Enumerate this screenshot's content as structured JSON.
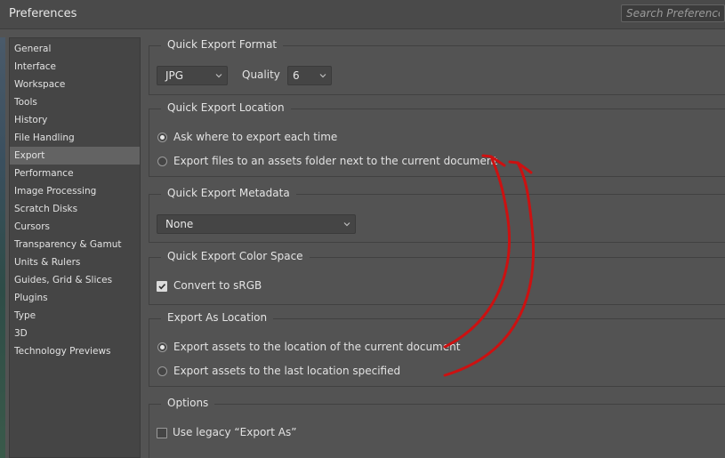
{
  "window": {
    "title": "Preferences",
    "search_placeholder": "Search Preferences"
  },
  "sidebar": {
    "items": [
      {
        "label": "General"
      },
      {
        "label": "Interface"
      },
      {
        "label": "Workspace"
      },
      {
        "label": "Tools"
      },
      {
        "label": "History"
      },
      {
        "label": "File Handling"
      },
      {
        "label": "Export",
        "active": true
      },
      {
        "label": "Performance"
      },
      {
        "label": "Image Processing"
      },
      {
        "label": "Scratch Disks"
      },
      {
        "label": "Cursors"
      },
      {
        "label": "Transparency & Gamut"
      },
      {
        "label": "Units & Rulers"
      },
      {
        "label": "Guides, Grid & Slices"
      },
      {
        "label": "Plugins"
      },
      {
        "label": "Type"
      },
      {
        "label": "3D"
      },
      {
        "label": "Technology Previews"
      }
    ]
  },
  "quick_export_format": {
    "title": "Quick Export Format",
    "format": "JPG",
    "quality_label": "Quality",
    "quality": "6"
  },
  "quick_export_location": {
    "title": "Quick Export Location",
    "options": [
      {
        "label": "Ask where to export each time",
        "checked": true
      },
      {
        "label": "Export files to an assets folder next to the current document",
        "checked": false
      }
    ]
  },
  "quick_export_metadata": {
    "title": "Quick Export Metadata",
    "value": "None"
  },
  "quick_export_color_space": {
    "title": "Quick Export Color Space",
    "convert_label": "Convert to sRGB",
    "checked": true
  },
  "export_as_location": {
    "title": "Export As Location",
    "options": [
      {
        "label": "Export assets to the location of the current document",
        "checked": true
      },
      {
        "label": "Export assets to the last location specified",
        "checked": false
      }
    ]
  },
  "options": {
    "title": "Options",
    "legacy_label": "Use legacy “Export As”",
    "checked": false
  },
  "annotation": {
    "color": "#cc1111"
  }
}
